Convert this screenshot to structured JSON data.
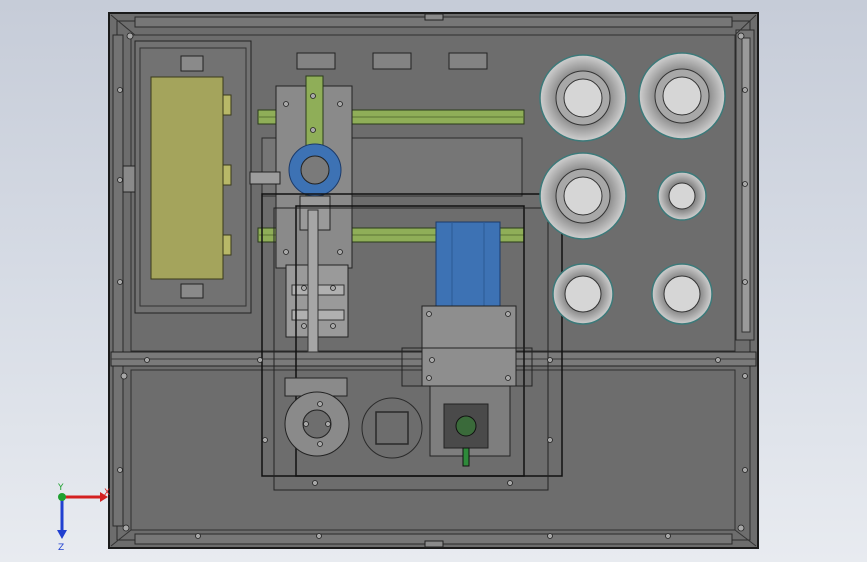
{
  "colors": {
    "background_top": "#c6ccd8",
    "background_bottom": "#e8ebf0",
    "plate": "#6d6d6d",
    "plate_edge": "#1e1e1e",
    "component_gray": "#8e8e8e",
    "panel_olive": "#a4a45c",
    "rail_green": "#8fae58",
    "motor_blue": "#3d72b4",
    "ring_teal": "#3c7a7a",
    "ring_light": "#c8c8c8",
    "axis_x": "#d42020",
    "axis_y": "#20a030",
    "axis_z": "#2040d0"
  },
  "triad": {
    "x_label": "X",
    "y_label": "Y",
    "z_label": "Z"
  },
  "icons": {
    "triad": "axis-triad-icon"
  }
}
